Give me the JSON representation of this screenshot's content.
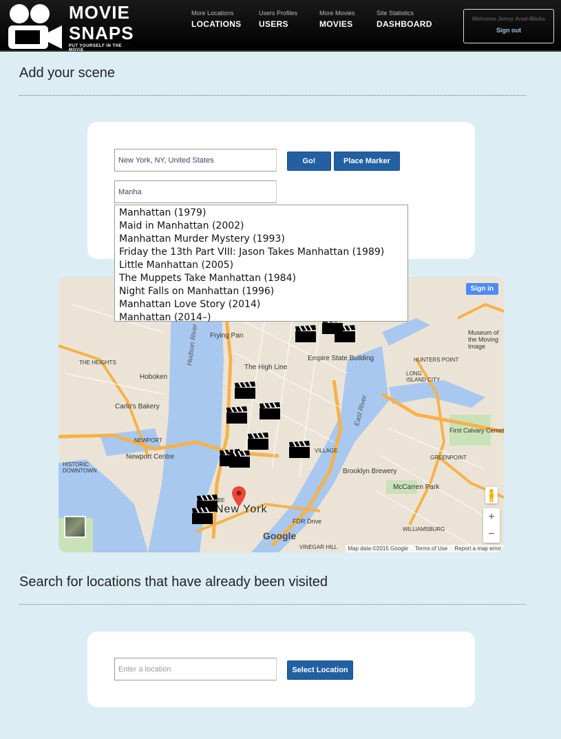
{
  "header": {
    "logo_line1": "MOVIE",
    "logo_line2": "SNAPS",
    "logo_tagline": "PUT YOURSELF IN THE MOVIE",
    "nav": [
      {
        "sub": "More Locations",
        "label": "LOCATIONS"
      },
      {
        "sub": "Users Profiles",
        "label": "USERS"
      },
      {
        "sub": "More Movies",
        "label": "MOVIES"
      },
      {
        "sub": "Site Statistics",
        "label": "DASHBOARD"
      }
    ],
    "welcome": "Welcome Jenny Arad-Marks",
    "signout": "Sign out"
  },
  "add_scene": {
    "title": "Add your scene",
    "location_value": "New York, NY, United States",
    "go_label": "Go!",
    "place_marker_label": "Place Marker",
    "movie_value": "Manha",
    "suggestions": [
      "Manhattan (1979)",
      "Maid in Manhattan (2002)",
      "Manhattan Murder Mystery (1993)",
      "Friday the 13th Part VIII: Jason Takes Manhattan (1989)",
      "Little Manhattan (2005)",
      "The Muppets Take Manhattan (1984)",
      "Night Falls on Manhattan (1996)",
      "Manhattan Love Story (2014)",
      "Manhattan (2014–)"
    ]
  },
  "map": {
    "signin": "Sign in",
    "city_label": "New York",
    "labels": {
      "hoboken": "Hoboken",
      "the_heights": "THE HEIGHTS",
      "carlos": "Carlo's Bakery",
      "newport": "NEWPORT",
      "newport_centre": "Newport Centre",
      "historic_downtown": "HISTORIC DOWNTOWN",
      "frying_pan": "Frying Pan",
      "high_line": "The High Line",
      "empire": "Empire State Building",
      "hunters_point": "HUNTERS POINT",
      "long_island_city": "LONG ISLAND CITY",
      "museum": "Museum of the Moving Image",
      "greenpoint": "GREENPOINT",
      "first_calvary": "First Calvary Cemetery",
      "brooklyn_brewery": "Brooklyn Brewery",
      "mccarren": "McCarren Park",
      "williamsburg": "WILLIAMSBURG",
      "village": "VILLAGE",
      "hudson_river": "Hudson River",
      "east_river": "East River",
      "fdr": "FDR Drive",
      "vinegar_hill": "VINEGAR HILL",
      "tribeca": "TRIBE"
    },
    "google": "Google",
    "attribution": "Map data ©2015 Google",
    "terms": "Terms of Use",
    "report": "Report a map error",
    "zoom_in": "+",
    "zoom_out": "−"
  },
  "search": {
    "title": "Search for locations that have already been visited",
    "placeholder": "Enter a location",
    "button_label": "Select Location"
  },
  "colors": {
    "page_bg": "#dcedf3",
    "button": "#2360a2",
    "header_bg": "#000000"
  }
}
